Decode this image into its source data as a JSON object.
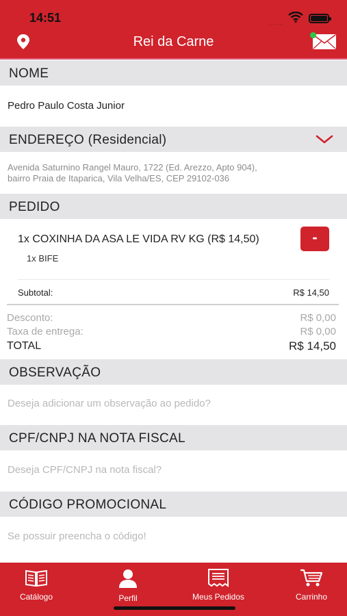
{
  "status_bar": {
    "time": "14:51",
    "signal": "....."
  },
  "header": {
    "title": "Rei da Carne",
    "left_icon": "location-pin-icon",
    "right_icon": "envelope-icon"
  },
  "nome": {
    "header": "NOME",
    "value": "Pedro Paulo Costa Junior"
  },
  "endereco": {
    "header": "ENDEREÇO (Residencial)",
    "line1": "Avenida Saturnino Rangel Mauro, 1722 (Ed. Arezzo, Apto 904),",
    "line2": "bairro Praia de Itaparica, Vila Velha/ES, CEP 29102-036"
  },
  "pedido": {
    "header": "PEDIDO",
    "item_line": "1x COXINHA DA ASA LE VIDA RV KG (R$ 14,50)",
    "item_sub": "1x BIFE",
    "remove_label": "-",
    "subtotal_label": "Subtotal:",
    "subtotal_value": "R$ 14,50",
    "desconto_label": "Desconto:",
    "desconto_value": "R$ 0,00",
    "taxa_label": "Taxa de entrega:",
    "taxa_value": "R$ 0,00",
    "total_label": "TOTAL",
    "total_value": "R$ 14,50"
  },
  "observacao": {
    "header": "OBSERVAÇÃO",
    "placeholder": "Deseja adicionar um observação ao pedido?"
  },
  "cpf": {
    "header": "CPF/CNPJ NA NOTA FISCAL",
    "placeholder": "Deseja CPF/CNPJ na nota fiscal?"
  },
  "promo": {
    "header": "CÓDIGO PROMOCIONAL",
    "placeholder": "Se possuir preencha o código!"
  },
  "tabs": [
    {
      "label": "Catálogo",
      "icon": "book-icon"
    },
    {
      "label": "Perfil",
      "icon": "user-icon"
    },
    {
      "label": "Meus Pedidos",
      "icon": "receipt-icon"
    },
    {
      "label": "Carrinho",
      "icon": "cart-icon"
    }
  ],
  "colors": {
    "brand": "#d0232c",
    "section_bg": "#e4e4e6",
    "placeholder": "#b8b8b8",
    "online_dot": "#2ec44a"
  }
}
